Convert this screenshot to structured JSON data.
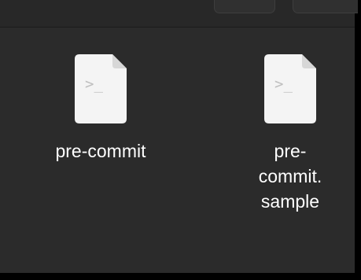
{
  "file_browser": {
    "items": [
      {
        "name": "pre-commit",
        "icon": "script-file-icon"
      },
      {
        "name": "pre-\ncommit.\nsample",
        "icon": "script-file-icon"
      }
    ],
    "colors": {
      "background": "#2b2b2b",
      "icon_paper": "#f4f4f4",
      "icon_fold": "#d7d7d7",
      "glyph": "#bfbfbf",
      "label": "#ffffff"
    }
  }
}
